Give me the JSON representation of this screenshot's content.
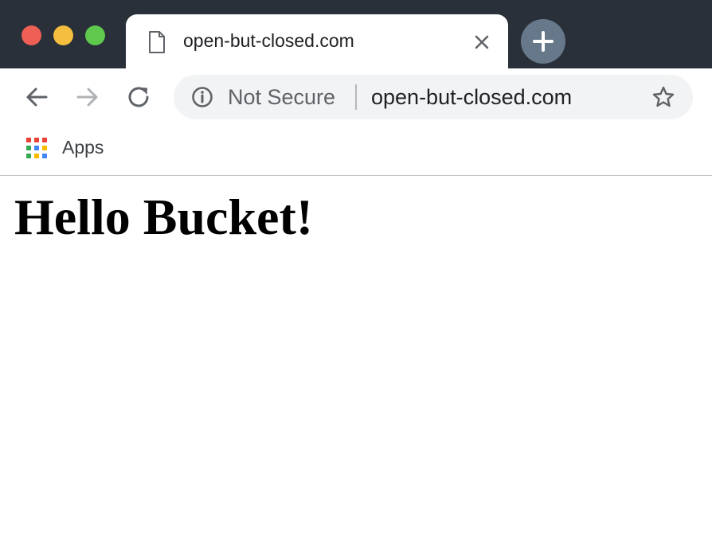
{
  "tab": {
    "title": "open-but-closed.com"
  },
  "omnibox": {
    "security_label": "Not Secure",
    "url": "open-but-closed.com"
  },
  "bookmarks": {
    "apps_label": "Apps"
  },
  "page": {
    "heading": "Hello Bucket!"
  },
  "colors": {
    "titlebar": "#293039",
    "traffic_close": "#ee5f56",
    "traffic_minimize": "#f6be3f",
    "traffic_maximize": "#5fc94e",
    "newtab_button": "#66788a",
    "omnibox_bg": "#f1f3f4"
  },
  "icons": {
    "tab": "document-icon",
    "tab_close": "close-icon",
    "newtab": "plus-icon",
    "back": "arrow-left-icon",
    "forward": "arrow-right-icon",
    "reload": "reload-icon",
    "security": "info-icon",
    "bookmark": "star-icon",
    "apps": "apps-grid-icon"
  }
}
